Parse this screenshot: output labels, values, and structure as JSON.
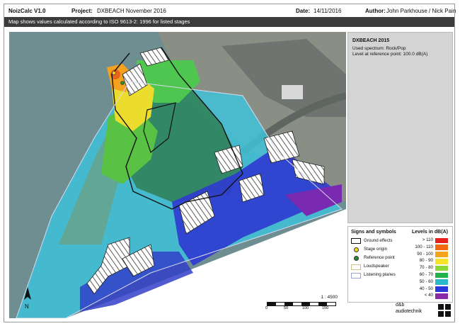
{
  "header": {
    "app": "NoizCalc V1.0",
    "project_label": "Project:",
    "project": "DXBEACH November 2016",
    "date_label": "Date:",
    "date": "14/11/2016",
    "author_label": "Author:",
    "author": "John Parkhouse / Nick Pain"
  },
  "subtitle": "Map shows values calculated according to ISO 9613-2: 1996 for listed stages",
  "info": {
    "title": "DXBEACH 2015",
    "line1": "Used spectrum:  Rock/Pop",
    "line2": "Level at reference point:  100.0 dB(A)"
  },
  "signs": {
    "title": "Signs and symbols",
    "items": [
      "Ground effects",
      "Stage origin",
      "Reference point",
      "Loudspeaker",
      "Listening planes"
    ]
  },
  "levels": {
    "title": "Levels in dB(A)",
    "items": [
      {
        "label": "> 110",
        "color": "#e8201c"
      },
      {
        "label": "100 - 110",
        "color": "#f06a12"
      },
      {
        "label": "90 - 100",
        "color": "#f5a31c"
      },
      {
        "label": "80 - 90",
        "color": "#f7e42a"
      },
      {
        "label": "70 - 80",
        "color": "#8cd83a"
      },
      {
        "label": "60 - 70",
        "color": "#22b04a"
      },
      {
        "label": "50 - 60",
        "color": "#2bb8c8"
      },
      {
        "label": "40 - 50",
        "color": "#2a3ad8"
      },
      {
        "label": "< 40",
        "color": "#8a2aa8"
      }
    ]
  },
  "scale": {
    "ratio": "1 : 4500",
    "ticks": [
      "0",
      "50",
      "100",
      "150"
    ]
  },
  "compass": "N",
  "brand": {
    "line1": "d&b",
    "line2": "audiotechnik"
  }
}
